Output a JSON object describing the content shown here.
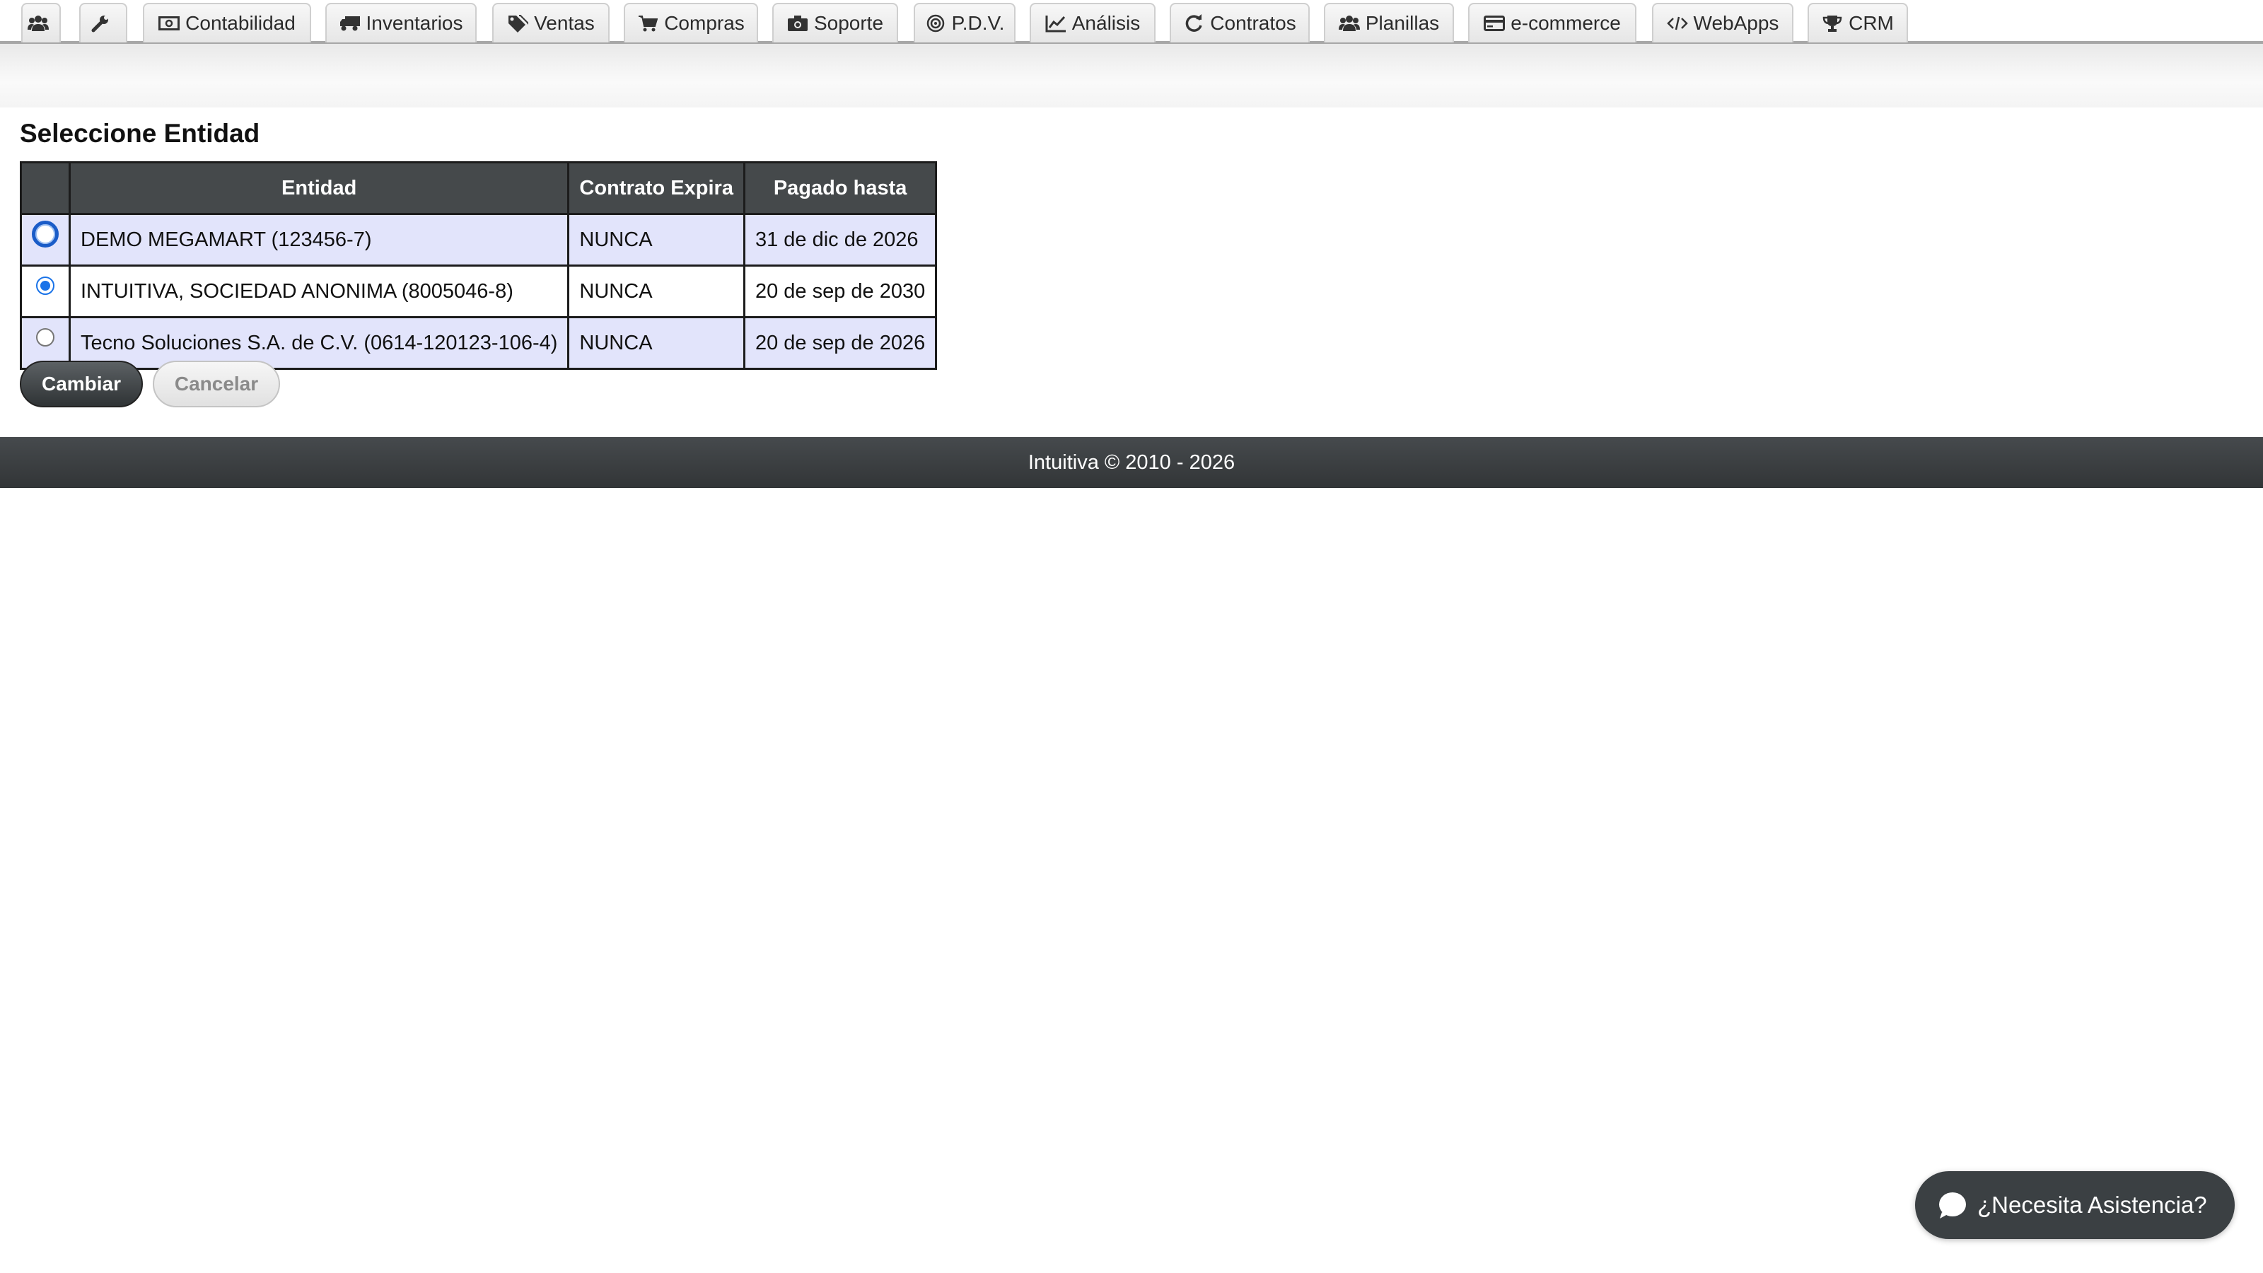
{
  "nav": {
    "tabs": [
      {
        "label": "",
        "icon": "users-icon"
      },
      {
        "label": "",
        "icon": "wrench-icon"
      },
      {
        "label": "Contabilidad",
        "icon": "money-icon"
      },
      {
        "label": "Inventarios",
        "icon": "truck-icon"
      },
      {
        "label": "Ventas",
        "icon": "tags-icon"
      },
      {
        "label": "Compras",
        "icon": "cart-icon"
      },
      {
        "label": "Soporte",
        "icon": "camera-icon"
      },
      {
        "label": "P.D.V.",
        "icon": "target-icon"
      },
      {
        "label": "Análisis",
        "icon": "line-chart-icon"
      },
      {
        "label": "Contratos",
        "icon": "refresh-icon"
      },
      {
        "label": "Planillas",
        "icon": "users-icon"
      },
      {
        "label": "e-commerce",
        "icon": "credit-card-icon"
      },
      {
        "label": "WebApps",
        "icon": "code-icon"
      },
      {
        "label": "CRM",
        "icon": "trophy-icon"
      }
    ]
  },
  "page": {
    "title": "Seleccione Entidad"
  },
  "table": {
    "headers": {
      "entity": "Entidad",
      "contract_expires": "Contrato Expira",
      "paid_until": "Pagado hasta"
    },
    "rows": [
      {
        "entity": "DEMO MEGAMART (123456-7)",
        "contract_expires": "NUNCA",
        "paid_until": "31 de dic de 2026",
        "selected": false,
        "focused": true
      },
      {
        "entity": "INTUITIVA, SOCIEDAD ANONIMA (8005046-8)",
        "contract_expires": "NUNCA",
        "paid_until": "20 de sep de 2030",
        "selected": true,
        "focused": false
      },
      {
        "entity": "Tecno Soluciones S.A. de C.V. (0614-120123-106-4)",
        "contract_expires": "NUNCA",
        "paid_until": "20 de sep de 2026",
        "selected": false,
        "focused": false
      }
    ]
  },
  "actions": {
    "change_label": "Cambiar",
    "cancel_label": "Cancelar"
  },
  "footer": {
    "text": "Intuitiva © 2010 - 2026"
  },
  "help": {
    "label": "¿Necesita Asistencia?"
  },
  "colors": {
    "header_bg": "#45494b",
    "row_alt": "#e2e4fb",
    "footer_bg": "#3a3e41",
    "radio_accent": "#1a73e8"
  }
}
